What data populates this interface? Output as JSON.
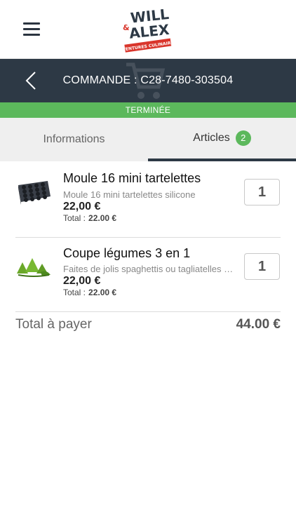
{
  "header": {
    "logo_text": [
      "WILL",
      "&",
      "ALEX",
      "AVENTURES CULINAIRES"
    ]
  },
  "order": {
    "title": "COMMANDE : C28-7480-303504",
    "status": "TERMINÉE"
  },
  "tabs": {
    "informations": "Informations",
    "articles": "Articles",
    "articles_count": "2"
  },
  "items": [
    {
      "name": "Moule 16 mini tartelettes",
      "description": "Moule 16 mini tartelettes silicone",
      "price": "22,00 €",
      "total_label": "Total :",
      "total_value": "22.00 €",
      "quantity": "1"
    },
    {
      "name": "Coupe légumes 3 en 1",
      "description": "Faites de jolis spaghettis ou tagliatelles de légumes",
      "price": "22,00 €",
      "total_label": "Total :",
      "total_value": "22.00 €",
      "quantity": "1"
    }
  ],
  "summary": {
    "label": "Total à  payer",
    "value": "44.00 €"
  },
  "colors": {
    "header_bar": "#2d3945",
    "status_green": "#5cb85c",
    "tab_bg": "#efefef",
    "logo_red": "#d9352b"
  }
}
